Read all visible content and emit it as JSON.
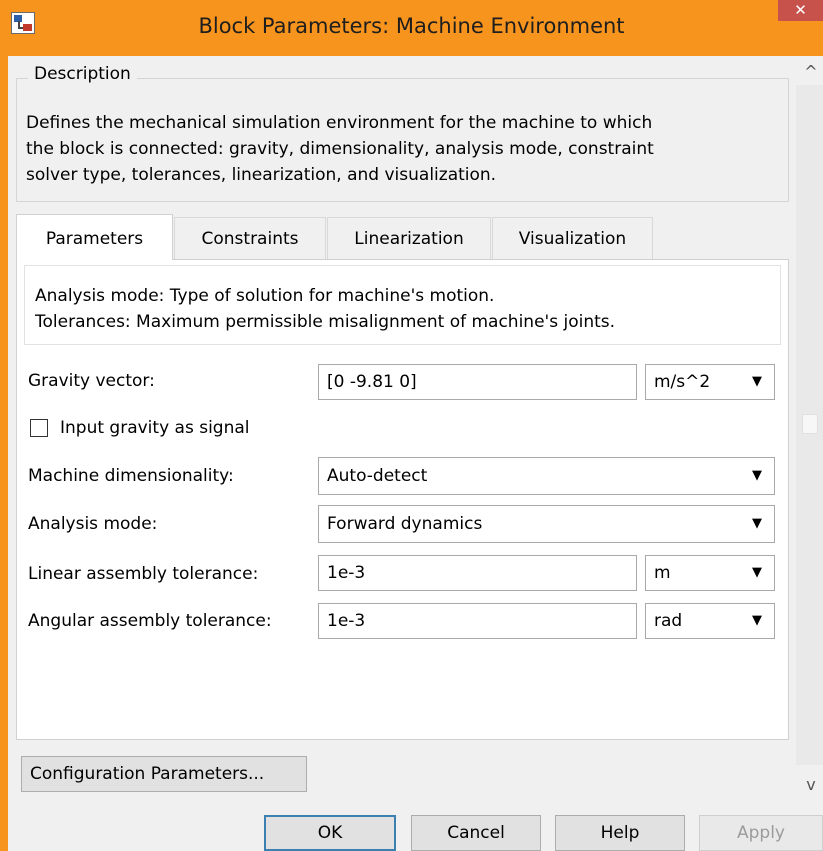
{
  "window": {
    "title": "Block Parameters: Machine Environment",
    "close_glyph": "✕",
    "accent_color": "#f7941d"
  },
  "description": {
    "group_title": "Description",
    "lines": [
      "Defines the mechanical simulation environment for the machine to which",
      "the block is connected: gravity, dimensionality, analysis mode, constraint",
      "solver type, tolerances, linearization, and visualization."
    ]
  },
  "tabs": [
    {
      "label": "Parameters",
      "active": true
    },
    {
      "label": "Constraints",
      "active": false
    },
    {
      "label": "Linearization",
      "active": false
    },
    {
      "label": "Visualization",
      "active": false
    }
  ],
  "help": {
    "lines": [
      "Analysis mode: Type of solution for machine's motion.",
      "Tolerances: Maximum permissible misalignment of machine's joints."
    ]
  },
  "params": {
    "gravity": {
      "label": "Gravity vector:",
      "value": "[0 -9.81 0]",
      "unit": "m/s^2"
    },
    "input_gravity": {
      "label": "Input gravity as signal",
      "checked": false
    },
    "dimensionality": {
      "label": "Machine dimensionality:",
      "value": "Auto-detect"
    },
    "analysis_mode": {
      "label": "Analysis mode:",
      "value": "Forward dynamics"
    },
    "linear_tol": {
      "label": "Linear assembly tolerance:",
      "value": "1e-3",
      "unit": "m"
    },
    "angular_tol": {
      "label": "Angular assembly tolerance:",
      "value": "1e-3",
      "unit": "rad"
    }
  },
  "buttons": {
    "config": "Configuration Parameters...",
    "ok": "OK",
    "cancel": "Cancel",
    "help": "Help",
    "apply": "Apply"
  },
  "icons": {
    "dropdown": "▼",
    "scroll_up": "^",
    "scroll_down": "v"
  }
}
